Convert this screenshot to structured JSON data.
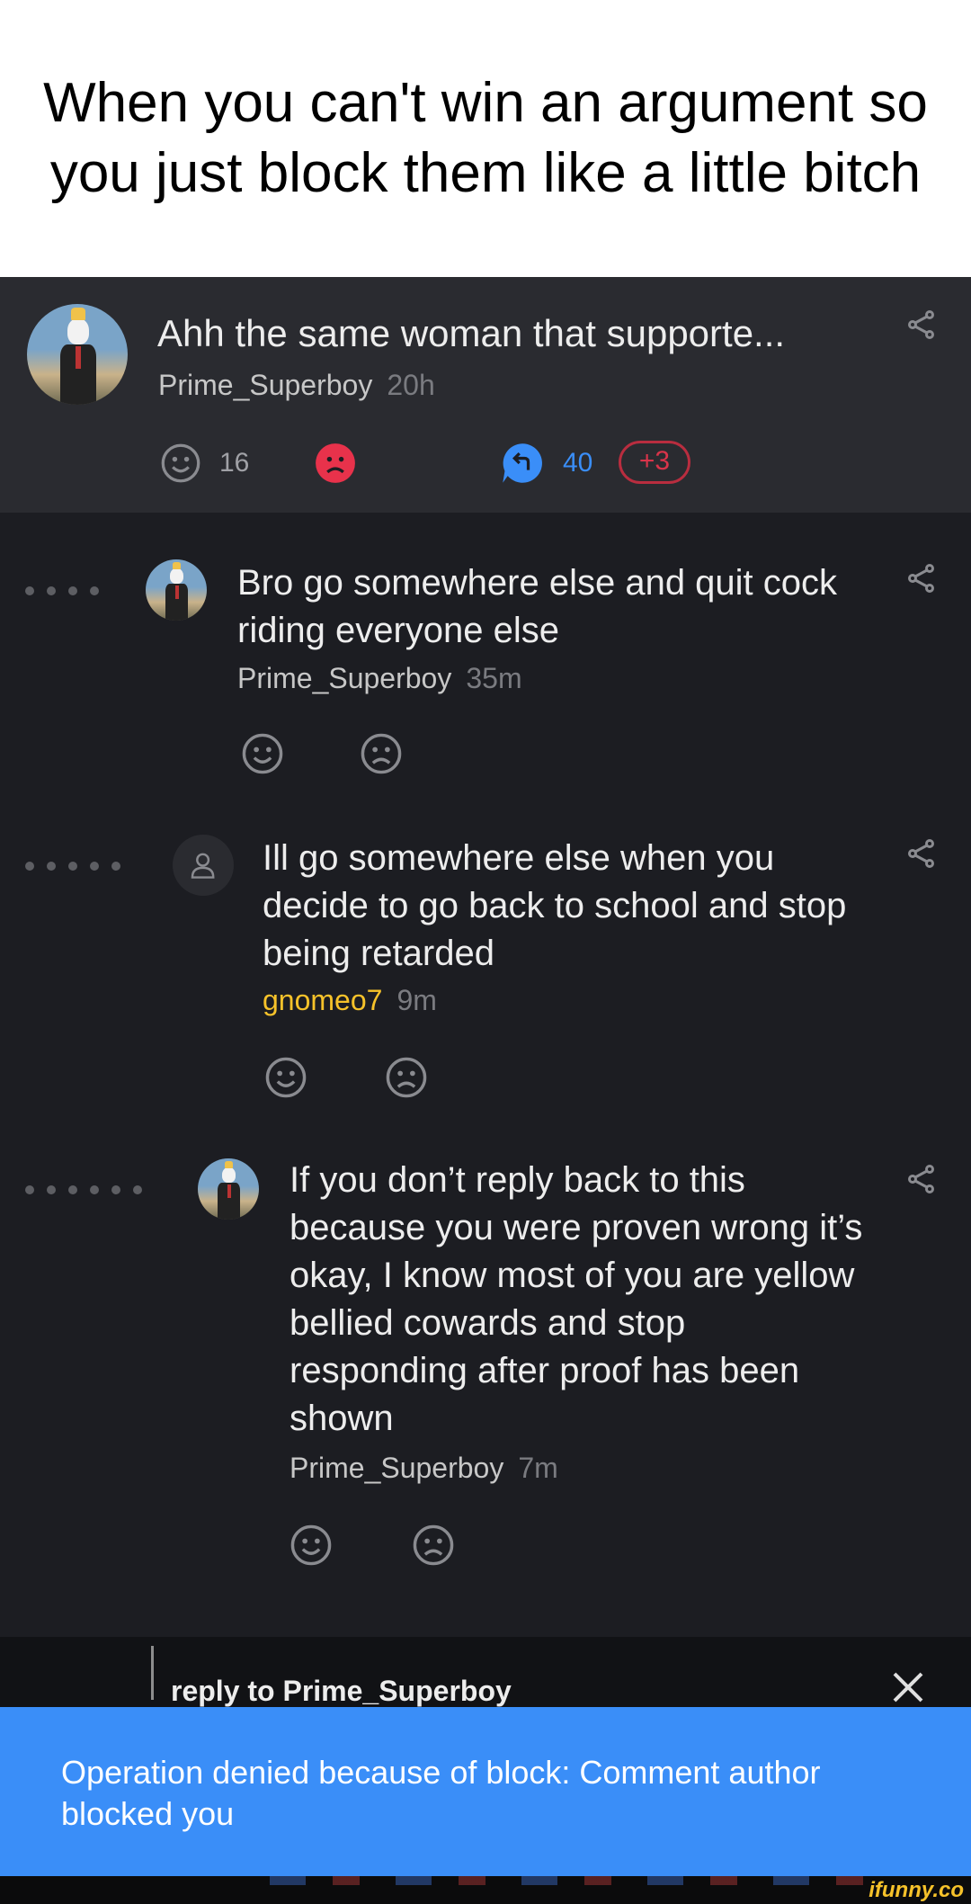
{
  "caption": "When you can't win an argument so you just block them like a little bitch",
  "parent_comment": {
    "text": "Ahh the same woman that supporte...",
    "author": "Prime_Superboy",
    "time": "20h",
    "smile_count": "16",
    "reply_count": "40",
    "new_replies": "+3"
  },
  "comments": [
    {
      "text": "Bro go somewhere else and quit cock riding everyone else",
      "author": "Prime_Superboy",
      "time": "35m"
    },
    {
      "text": "Ill go somewhere else when you decide to go back to school and stop being retarded",
      "author": "gnomeo7",
      "time": "9m"
    },
    {
      "text": "If you don’t reply back to this because you were proven wrong it’s okay, I know most of you are yellow bellied cowards and stop responding after proof has been shown",
      "author": "Prime_Superboy",
      "time": "7m"
    }
  ],
  "reply_bar": {
    "label": "reply to Prime_Superboy"
  },
  "toast": {
    "message": "Operation denied because of block: Comment author blocked you"
  },
  "watermark": "ifunny.co",
  "colors": {
    "toast_bg": "#3a8ef8",
    "reply_blue": "#3a8ef8",
    "unsmile_red": "#e8324b",
    "author_gold": "#f6c22a"
  }
}
